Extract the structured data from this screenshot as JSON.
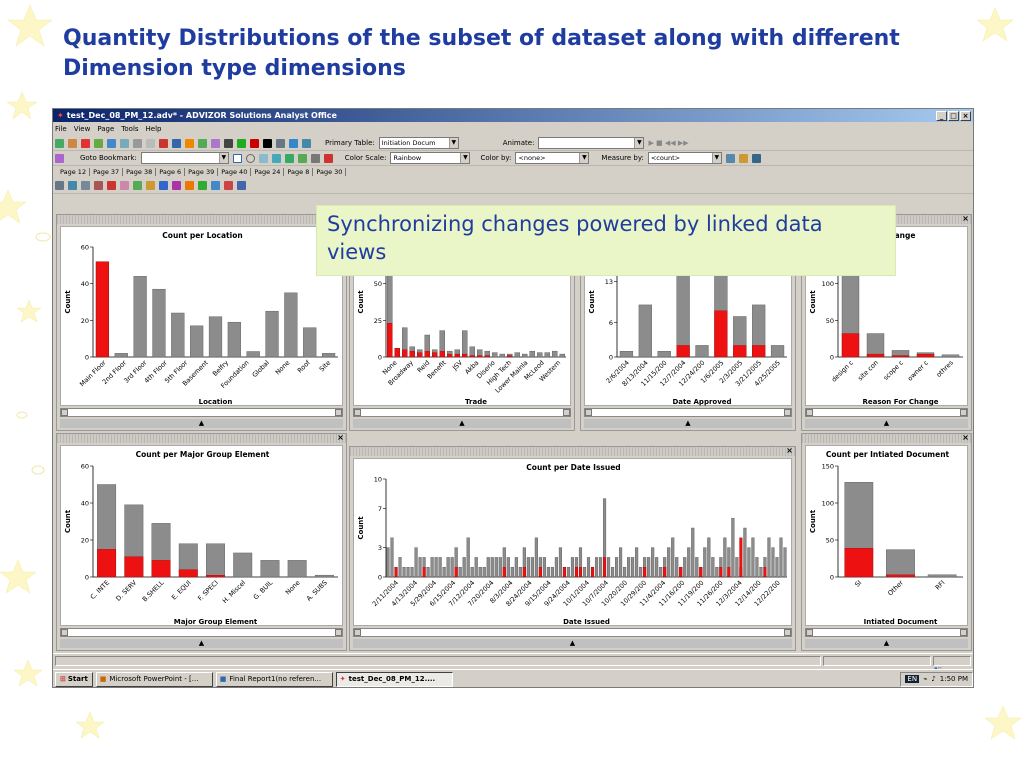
{
  "slide": {
    "title": "Quantity Distributions of the subset of dataset along with different Dimension type dimensions",
    "callout": "Synchronizing changes powered by linked data views"
  },
  "window": {
    "title": "test_Dec_08_PM_12.adv* - ADVIZOR Solutions Analyst Office",
    "controls": [
      "_",
      "□",
      "×"
    ]
  },
  "menu": [
    "File",
    "View",
    "Page",
    "Tools",
    "Help"
  ],
  "toolbar1": {
    "primary_table_label": "Primary Table:",
    "primary_table_value": "Initiation Docum",
    "animate_label": "Animate:",
    "animate_value": ""
  },
  "toolbar2": {
    "goto_bookmark_label": "Goto Bookmark:",
    "goto_bookmark_value": "",
    "color_scale_label": "Color Scale:",
    "color_scale_value": "Rainbow",
    "color_by_label": "Color by:",
    "color_by_value": "<none>",
    "measure_by_label": "Measure by:",
    "measure_by_value": "<count>"
  },
  "page_tabs": [
    "Page 12",
    "Page 37",
    "Page 38",
    "Page 6",
    "Page 39",
    "Page 40",
    "Page 24",
    "Page 8",
    "Page 30"
  ],
  "colors": {
    "bar": "#8c8c8c",
    "highlight": "#ee1111",
    "title_blue": "#1f3da0",
    "callout_bg": "#eaf5c8"
  },
  "panels": {
    "location": {
      "footer": "Location"
    },
    "trade": {
      "footer": "Trade"
    },
    "date_approved": {
      "footer": "Date Approved"
    },
    "reason": {
      "footer": "Reason For Change"
    },
    "major_group": {
      "footer": "Major Group Element"
    },
    "date_issued": {
      "footer": "Date Issued"
    },
    "initiated_doc": {
      "footer": "Intiated Document"
    }
  },
  "chart_data": [
    {
      "id": "location",
      "type": "bar",
      "title": "Count per Location",
      "xlabel": "Location",
      "ylabel": "Count",
      "ylim": [
        0,
        60
      ],
      "yticks": [
        0,
        20,
        40,
        60
      ],
      "categories": [
        "Main Floor",
        "2nd Floor",
        "3rd Floor",
        "4th Floor",
        "5th Floor",
        "Basement",
        "Belfry",
        "Foundation",
        "Global",
        "None",
        "Roof",
        "Site"
      ],
      "series": [
        {
          "name": "total",
          "values": [
            52,
            2,
            44,
            37,
            24,
            17,
            22,
            19,
            3,
            25,
            35,
            16,
            2
          ]
        },
        {
          "name": "selected",
          "values": [
            52,
            0,
            0,
            0,
            0,
            0,
            0,
            0,
            0,
            0,
            0,
            0,
            0
          ]
        }
      ]
    },
    {
      "id": "trade",
      "type": "bar",
      "title": "",
      "xlabel": "Trade",
      "ylabel": "Count",
      "ylim": [
        0,
        75
      ],
      "yticks": [
        0,
        25,
        50,
        75
      ],
      "categories": [
        "None",
        "Broadway",
        "Reid",
        "Benefit",
        "JSV",
        "Akba",
        "Diserio",
        "High Tech",
        "Lower Mainla",
        "McLeod",
        "Western"
      ],
      "series": [
        {
          "name": "total",
          "values": [
            80,
            6,
            20,
            7,
            5,
            15,
            5,
            18,
            4,
            5,
            18,
            7,
            5,
            4,
            3,
            2,
            2,
            3,
            2,
            4,
            3,
            3,
            4,
            2
          ]
        },
        {
          "name": "selected",
          "values": [
            23,
            6,
            5,
            4,
            3,
            4,
            3,
            4,
            2,
            2,
            2,
            1,
            1,
            1,
            0,
            0,
            1,
            0,
            0,
            0,
            0,
            0,
            0,
            0
          ]
        }
      ]
    },
    {
      "id": "date_approved",
      "type": "bar",
      "title": "",
      "xlabel": "Date Approved",
      "ylabel": "Count",
      "ylim": [
        0,
        19
      ],
      "yticks": [
        0,
        6,
        13,
        19
      ],
      "categories": [
        "2/6/2004",
        "8/13/2004",
        "11/15/200",
        "12/7/2004",
        "12/24/200",
        "1/6/2005",
        "2/3/2005",
        "3/21/2005",
        "4/25/2005"
      ],
      "series": [
        {
          "name": "total",
          "values": [
            1,
            9,
            1,
            18,
            2,
            20,
            7,
            9,
            2
          ]
        },
        {
          "name": "selected",
          "values": [
            0,
            0,
            0,
            2,
            0,
            8,
            2,
            2,
            0
          ]
        }
      ]
    },
    {
      "id": "reason",
      "type": "bar",
      "title": "n For Change",
      "xlabel": "Reason For Change",
      "ylabel": "Count",
      "ylim": [
        0,
        150
      ],
      "yticks": [
        0,
        50,
        100,
        150
      ],
      "categories": [
        "design c",
        "site con",
        "scope c",
        "owner c",
        "othres"
      ],
      "series": [
        {
          "name": "total",
          "values": [
            150,
            32,
            9,
            6,
            3
          ]
        },
        {
          "name": "selected",
          "values": [
            32,
            4,
            2,
            4,
            0
          ]
        }
      ]
    },
    {
      "id": "major_group",
      "type": "bar",
      "title": "Count per Major Group Element",
      "xlabel": "Major Group Element",
      "ylabel": "Count",
      "ylim": [
        0,
        60
      ],
      "yticks": [
        0,
        20,
        40,
        60
      ],
      "categories": [
        "C. INTE",
        "D. SERV",
        "B.SHELL",
        "E. EQUI",
        "F. SPECI",
        "H. Miscel",
        "G. BUIL",
        "None",
        "A. SUBS"
      ],
      "series": [
        {
          "name": "total",
          "values": [
            50,
            39,
            29,
            18,
            18,
            13,
            9,
            9,
            1
          ]
        },
        {
          "name": "selected",
          "values": [
            15,
            11,
            9,
            4,
            1,
            0,
            0,
            0,
            0
          ]
        }
      ]
    },
    {
      "id": "date_issued",
      "type": "bar",
      "title": "Count per  Date  Issued",
      "xlabel": "Date  Issued",
      "ylabel": "Count",
      "ylim": [
        0,
        10
      ],
      "yticks": [
        0,
        3,
        7,
        10
      ],
      "categories": [
        "2/11/2004",
        "4/13/2004",
        "5/29/2004",
        "6/15/2004",
        "7/12/2004",
        "7/20/2004",
        "8/3/2004",
        "8/24/2004",
        "9/15/2004",
        "9/24/2004",
        "10/1/2004",
        "10/7/2004",
        "10/20/200",
        "10/29/200",
        "11/4/2004",
        "11/16/200",
        "11/19/200",
        "11/26/200",
        "12/3/2004",
        "12/14/200",
        "12/22/200"
      ],
      "series": [
        {
          "name": "total",
          "values": [
            3,
            4,
            1,
            2,
            1,
            1,
            1,
            3,
            2,
            2,
            1,
            2,
            2,
            2,
            1,
            2,
            2,
            3,
            1,
            2,
            4,
            1,
            2,
            1,
            1,
            2,
            2,
            2,
            2,
            3,
            2,
            1,
            2,
            1,
            3,
            2,
            2,
            4,
            2,
            2,
            1,
            1,
            2,
            3,
            1,
            1,
            2,
            2,
            3,
            1,
            2,
            1,
            2,
            2,
            8,
            2,
            1,
            2,
            3,
            1,
            2,
            2,
            3,
            1,
            2,
            2,
            3,
            2,
            1,
            2,
            3,
            4,
            2,
            1,
            2,
            3,
            5,
            2,
            1,
            3,
            4,
            2,
            1,
            2,
            4,
            3,
            6,
            2,
            1,
            5,
            3,
            4,
            2,
            1,
            2,
            4,
            3,
            2,
            4,
            3
          ]
        },
        {
          "name": "selected",
          "values": [
            0,
            0,
            1,
            0,
            0,
            0,
            0,
            0,
            0,
            1,
            0,
            0,
            0,
            0,
            0,
            0,
            0,
            1,
            0,
            0,
            0,
            0,
            0,
            0,
            0,
            0,
            0,
            0,
            0,
            1,
            0,
            0,
            0,
            0,
            1,
            0,
            0,
            0,
            1,
            0,
            0,
            0,
            0,
            0,
            1,
            0,
            0,
            1,
            1,
            0,
            0,
            1,
            0,
            0,
            2,
            0,
            0,
            0,
            0,
            0,
            0,
            0,
            0,
            0,
            1,
            0,
            0,
            0,
            0,
            1,
            0,
            0,
            0,
            1,
            0,
            0,
            0,
            0,
            1,
            0,
            0,
            0,
            0,
            1,
            0,
            1,
            0,
            0,
            4,
            0,
            0,
            0,
            0,
            0,
            1,
            0,
            0,
            0,
            0,
            0
          ]
        }
      ]
    },
    {
      "id": "initiated_doc",
      "type": "bar",
      "title": "Count per Intiated Document",
      "xlabel": "Intiated Document",
      "ylabel": "Count",
      "ylim": [
        0,
        150
      ],
      "yticks": [
        0,
        50,
        100,
        150
      ],
      "categories": [
        "SI",
        "Other",
        "RFI"
      ],
      "series": [
        {
          "name": "total",
          "values": [
            128,
            37,
            3
          ]
        },
        {
          "name": "selected",
          "values": [
            39,
            3,
            0
          ]
        }
      ]
    }
  ],
  "taskbar": {
    "start_label": "Start",
    "items": [
      "Microsoft PowerPoint - [...",
      "Final Report1(no referen...",
      "test_Dec_08_PM_12...."
    ],
    "tray_lang": "EN",
    "clock": "1:50 PM"
  }
}
